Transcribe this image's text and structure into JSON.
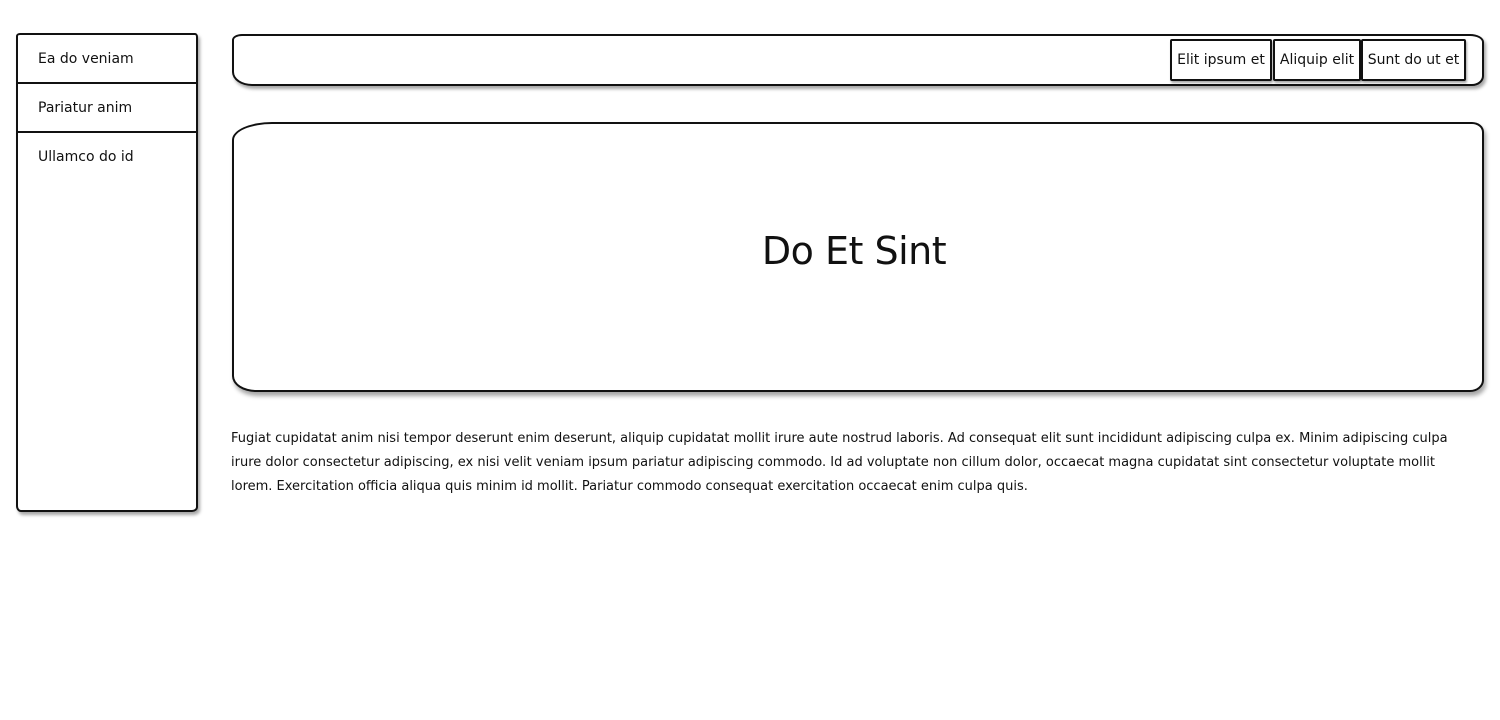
{
  "sidebar": {
    "items": [
      {
        "label": "Ea do veniam"
      },
      {
        "label": "Pariatur anim"
      },
      {
        "label": "Ullamco do id"
      }
    ]
  },
  "topbar": {
    "nav": [
      {
        "label": "Elit ipsum et"
      },
      {
        "label": "Aliquip elit"
      },
      {
        "label": "Sunt do ut et"
      }
    ]
  },
  "hero": {
    "title": "Do Et Sint"
  },
  "content": {
    "paragraph": "Fugiat cupidatat anim nisi tempor deserunt enim deserunt, aliquip cupidatat mollit irure aute nostrud laboris. Ad consequat elit sunt incididunt adipiscing culpa ex. Minim adipiscing culpa irure dolor consectetur adipiscing, ex nisi velit veniam ipsum pariatur adipiscing commodo. Id ad voluptate non cillum dolor, occaecat magna cupidatat sint consectetur voluptate mollit lorem. Exercitation officia aliqua quis minim id mollit. Pariatur commodo consequat exercitation occaecat enim culpa quis."
  }
}
